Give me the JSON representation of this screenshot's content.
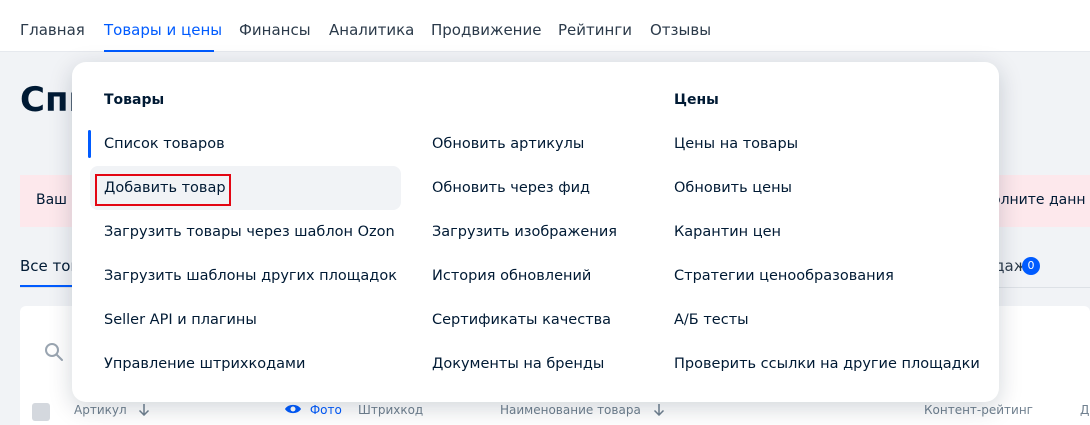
{
  "topnav": {
    "items": [
      "Главная",
      "Товары и цены",
      "Финансы",
      "Аналитика",
      "Продвижение",
      "Рейтинги",
      "Отзывы"
    ],
    "active_index": 1
  },
  "background": {
    "page_title": "Спи",
    "alert_left": "Ваш а",
    "alert_right": "олните данн",
    "tab_all": "Все тов",
    "tab_sales": "одажи",
    "tab_sales_badge": "0",
    "table_headers": {
      "article": "Артикул",
      "photo": "Фото",
      "barcode": "Штрихкод",
      "name": "Наименование товара",
      "rating": "Контент-рейтинг",
      "last": "Д"
    }
  },
  "dropdown": {
    "col1_title": "Товары",
    "col3_title": "Цены",
    "col1": [
      "Список товаров",
      "Добавить товар",
      "Загрузить товары через шаблон Ozon",
      "Загрузить шаблоны других площадок",
      "Seller API и плагины",
      "Управление штрихкодами"
    ],
    "col2": [
      "Обновить артикулы",
      "Обновить через фид",
      "Загрузить изображения",
      "История обновлений",
      "Сертификаты качества",
      "Документы на бренды"
    ],
    "col3": [
      "Цены на товары",
      "Обновить цены",
      "Карантин цен",
      "Стратегии ценообразования",
      "А/Б тесты",
      "Проверить ссылки на другие площадки"
    ],
    "active_item": "Список товаров",
    "highlighted_item": "Добавить товар"
  },
  "colors": {
    "accent": "#005bff",
    "highlight_border": "#e30613",
    "alert_bg": "#fde8ec"
  }
}
